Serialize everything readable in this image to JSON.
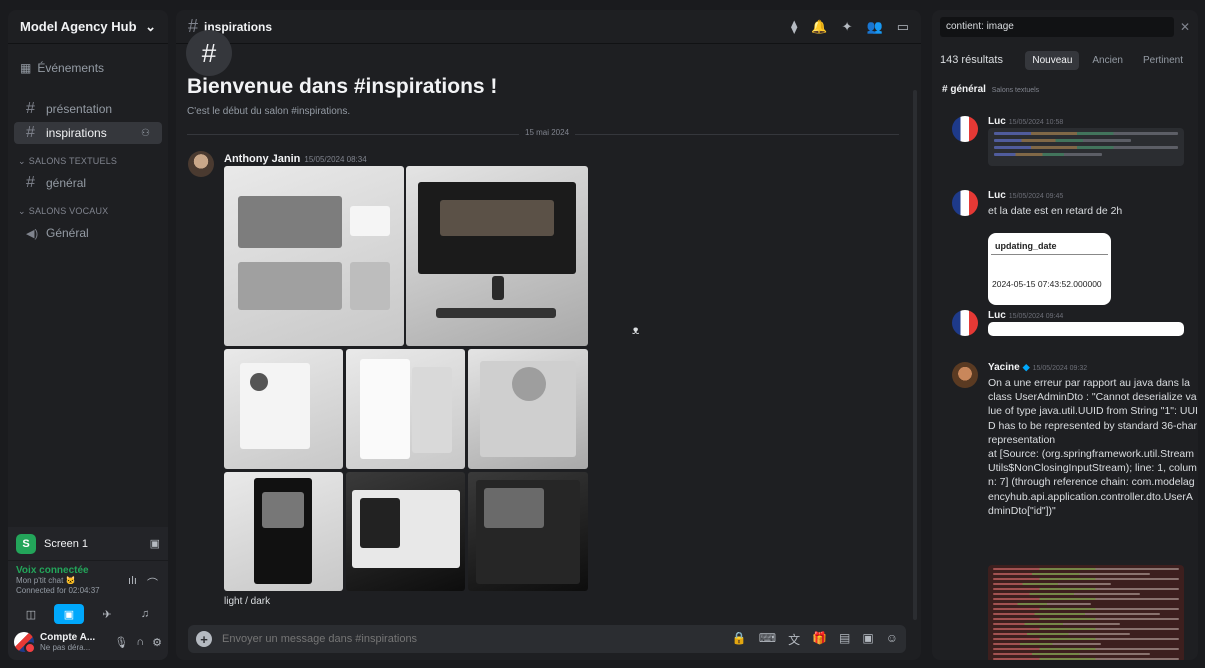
{
  "sidebar": {
    "server_name": "Model Agency Hub",
    "events_label": "Événements",
    "channels": [
      {
        "label": "présentation"
      },
      {
        "label": "inspirations"
      }
    ],
    "categories": [
      {
        "label": "SALONS TEXTUELS",
        "channels": [
          {
            "label": "général"
          }
        ]
      },
      {
        "label": "SALONS VOCAUX",
        "channels": [
          {
            "label": "Général"
          }
        ]
      }
    ]
  },
  "screen_share": {
    "label": "Screen 1"
  },
  "voice": {
    "title": "Voix connectée",
    "channel": "Mon p'tit chat 🐱",
    "connected_for": "Connected for 02:04:37"
  },
  "user": {
    "name": "Compte A...",
    "status": "Ne pas déra..."
  },
  "chat": {
    "channel": "inspirations",
    "welcome_title": "Bienvenue dans #inspirations !",
    "welcome_sub": "C'est le début du salon #inspirations.",
    "date_divider": "15 mai 2024",
    "message": {
      "author": "Anthony Janin",
      "time": "15/05/2024 08:34",
      "caption": "light / dark"
    },
    "input_placeholder": "Envoyer un message dans #inspirations"
  },
  "search": {
    "query": "contient: image",
    "results_count": "143 résultats",
    "sort_tabs": [
      "Nouveau",
      "Ancien",
      "Pertinent"
    ],
    "channel": "# général",
    "channel_hint": "Salons textuels",
    "results": [
      {
        "author": "Luc",
        "time": "15/05/2024 10:58",
        "text": ""
      },
      {
        "author": "Luc",
        "time": "15/05/2024 09:45",
        "text": "et la date est en retard de 2h",
        "card_header": "updating_date",
        "card_value": "2024-05-15 07:43:52.000000"
      },
      {
        "author": "Luc",
        "time": "15/05/2024 09:44",
        "text": ""
      },
      {
        "author": "Yacine",
        "time": "15/05/2024 09:32",
        "text": "On a une erreur par rapport au java dans la class UserAdminDto : \"Cannot deserialize value of type java.util.UUID from String \"1\": UUID has to be represented by standard 36-char representation\n at [Source: (org.springframework.util.StreamUtils$NonClosingInputStream); line: 1, column: 7] (through reference chain: com.modelagencyhub.api.application.controller.dto.UserAdminDto[\"id\"])\""
      }
    ]
  },
  "colors": {
    "accent": "#00a8fc",
    "voice_green": "#23a55a",
    "dnd_red": "#f23f43"
  }
}
